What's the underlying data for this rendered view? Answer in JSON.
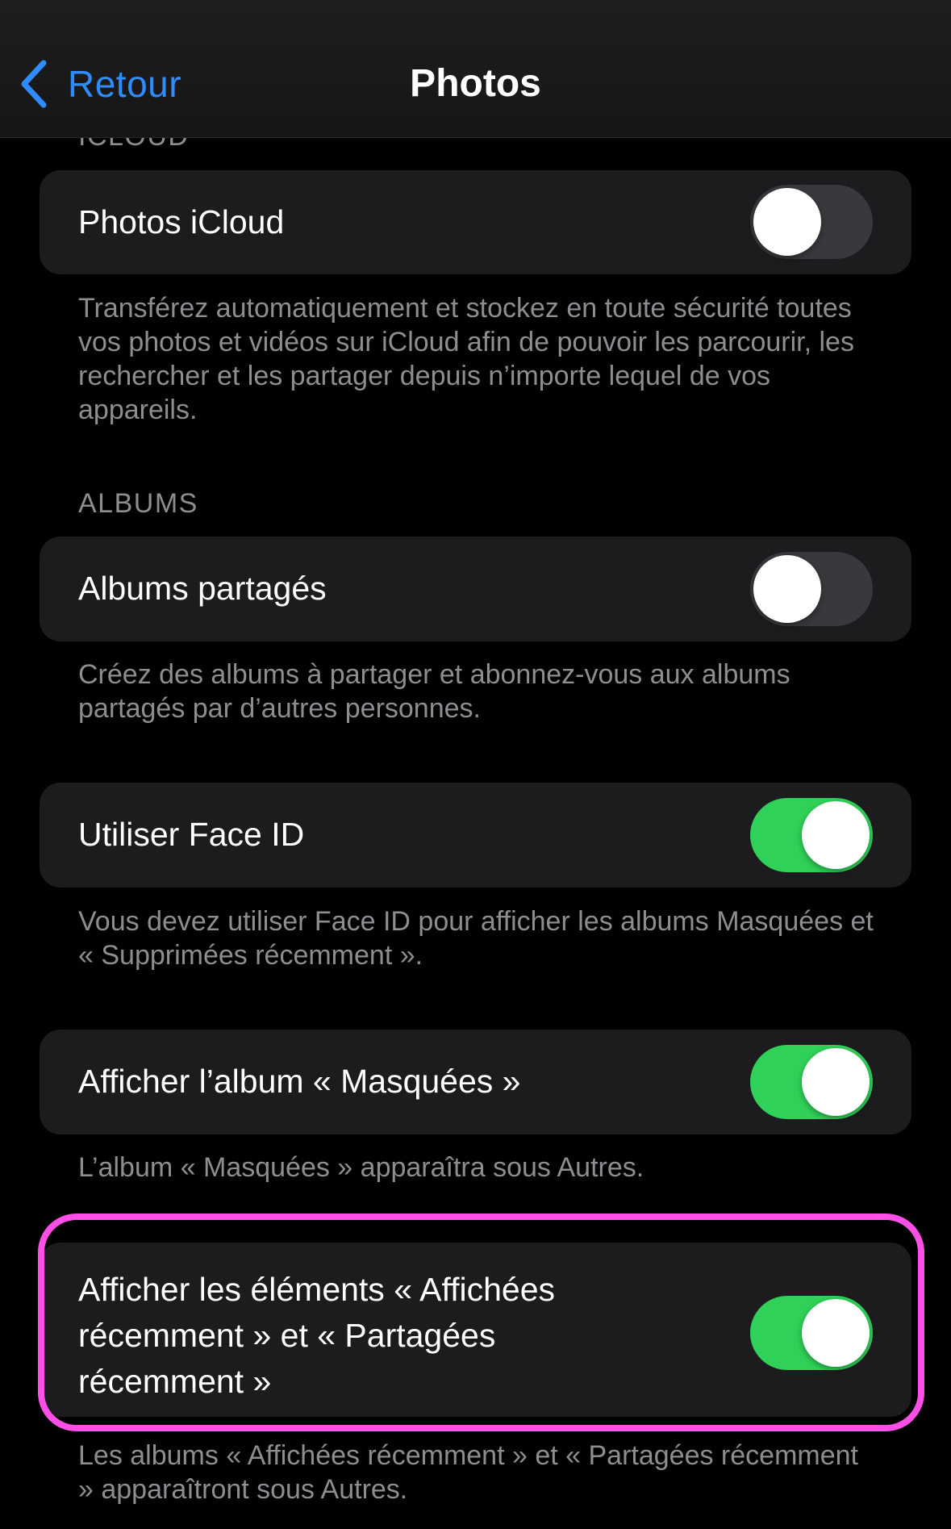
{
  "navbar": {
    "back_label": "Retour",
    "title": "Photos"
  },
  "sections": {
    "icloud_header": "ICLOUD",
    "albums_header": "ALBUMS"
  },
  "rows": {
    "icloud_photos": {
      "label": "Photos iCloud",
      "on": false,
      "footer": "Transférez automatiquement et stockez en toute sécurité toutes vos photos et vidéos sur iCloud afin de pouvoir les parcourir, les rechercher et les partager depuis n’importe lequel de vos appareils."
    },
    "shared_albums": {
      "label": "Albums partagés",
      "on": false,
      "footer": "Créez des albums à partager et abonnez-vous aux albums partagés par d’autres personnes."
    },
    "face_id": {
      "label": "Utiliser Face ID",
      "on": true,
      "footer": "Vous devez utiliser Face ID pour afficher les albums Masquées et « Supprimées récemment »."
    },
    "hidden_album": {
      "label": "Afficher l’album « Masquées »",
      "on": true,
      "footer": "L’album « Masquées » apparaîtra sous Autres."
    },
    "recent_items": {
      "label": "Afficher les éléments « Affichées récemment » et « Partagées récemment »",
      "on": true,
      "footer": "Les albums « Affichées récemment » et « Partagées récemment » apparaîtront sous Autres."
    }
  },
  "colors": {
    "accent": "#2f8cff",
    "toggle_on": "#30d158",
    "toggle_off": "#39393d",
    "highlight": "#ff4fe6"
  }
}
